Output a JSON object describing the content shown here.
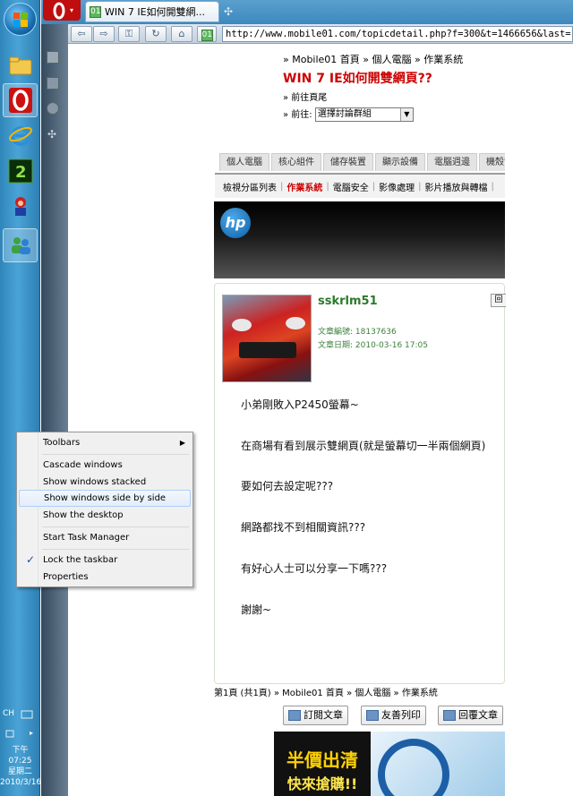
{
  "browser": {
    "tab_title": "WIN 7 IE如何開雙網...",
    "url": "http://www.mobile01.com/topicdetail.php?f=300&t=1466656&last=18137636",
    "new_tab_glyph": "✣"
  },
  "page": {
    "breadcrumb": "» Mobile01 首頁 » 個人電腦 » 作業系統",
    "title": "WIN 7 IE如何開雙網頁??",
    "goto_home": "» 前往頁尾",
    "goto_label": "» 前往:",
    "goto_select": "選擇討論群組",
    "category_tabs": [
      "個人電腦",
      "核心組件",
      "儲存裝置",
      "顯示設備",
      "電腦週邊",
      "機殼散熱"
    ],
    "subnav": [
      "檢視分區列表",
      "作業系統",
      "電腦安全",
      "影像處理",
      "影片播放與轉檔"
    ],
    "banner_logo": "hp",
    "post": {
      "username": "sskrlm51",
      "reply_short": "回",
      "article_id_label": "文章編號: 18137636",
      "article_date_label": "文章日期: 2010-03-16 17:05",
      "lines": [
        "小弟剛敗入P2450螢幕~",
        "在商場有看到展示雙網頁(就是螢幕切一半兩個網頁)",
        "要如何去設定呢???",
        "網路都找不到相關資訊???",
        "有好心人士可以分享一下嗎???",
        "謝謝~"
      ]
    },
    "footer_crumb": "第1頁 (共1頁) » Mobile01 首頁 » 個人電腦 » 作業系統",
    "buttons": {
      "subscribe": "訂閱文章",
      "friends": "友善列印",
      "reply": "回覆文章"
    },
    "ad": {
      "line1": "半價出清",
      "line2": "快來搶購!!"
    }
  },
  "context_menu": {
    "toolbars": "Toolbars",
    "cascade": "Cascade windows",
    "stacked": "Show windows stacked",
    "side_by_side": "Show windows side by side",
    "desktop": "Show the desktop",
    "task_manager": "Start Task Manager",
    "lock": "Lock the taskbar",
    "properties": "Properties"
  },
  "tray": {
    "lang": "CH",
    "time": "下午 07:25",
    "weekday": "星期二",
    "date": "2010/3/16"
  },
  "colors": {
    "title_red": "#cc0000",
    "user_green": "#2a7a2a",
    "taskbar_blue": "#3b93c8"
  }
}
